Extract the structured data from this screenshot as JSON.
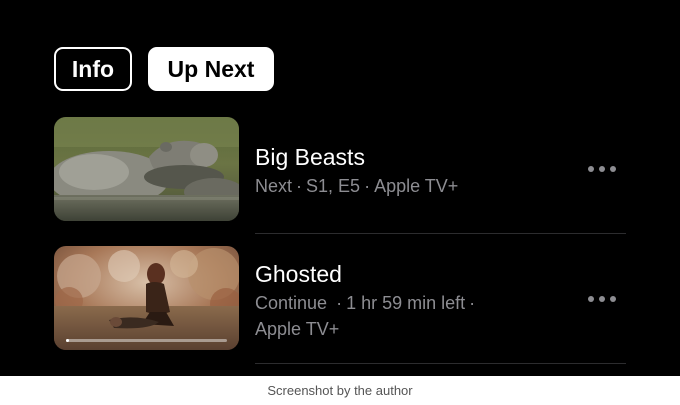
{
  "tabs": {
    "info": "Info",
    "up_next": "Up Next",
    "selected": "Up Next"
  },
  "items": [
    {
      "title": "Big Beasts",
      "status": "Next",
      "episode": "S1, E5",
      "provider": "Apple TV+",
      "thumbnail": "hippo-in-water-image"
    },
    {
      "title": "Ghosted",
      "status": "Continue",
      "time_left": "1 hr 59 min left",
      "provider": "Apple TV+",
      "progress": 0.02,
      "thumbnail": "action-scene-explosion-image"
    }
  ],
  "icons": {
    "more": "ellipsis-icon"
  },
  "caption": "Screenshot by the author",
  "colors": {
    "background": "#000000",
    "title": "#ffffff",
    "meta": "#8d8d92",
    "divider": "#2c2c2e"
  }
}
